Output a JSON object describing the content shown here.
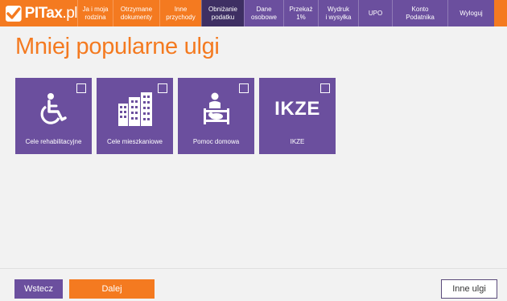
{
  "logo": {
    "text_main": "PITax",
    "text_suffix": ".pl"
  },
  "nav": [
    {
      "label": "Ja i moja\nrodzina",
      "style": "orange",
      "width": 44
    },
    {
      "label": "Otrzymane\ndokumenty",
      "style": "orange",
      "width": 58
    },
    {
      "label": "Inne\nprzychody",
      "style": "orange",
      "width": 52
    },
    {
      "label": "Obniżanie\npodatku",
      "style": "active",
      "width": 53
    },
    {
      "label": "Dane\nosobowe",
      "style": "purple",
      "width": 49
    },
    {
      "label": "Przekaż\n1%",
      "style": "purple",
      "width": 43
    },
    {
      "label": "Wydruk\ni wysyłka",
      "style": "purple",
      "width": 50
    },
    {
      "label": "UPO",
      "style": "purple",
      "width": 42
    },
    {
      "label": "Konto\nPodatnika",
      "style": "purple",
      "width": 69
    },
    {
      "label": "Wyloguj",
      "style": "purple",
      "width": 58
    }
  ],
  "page": {
    "title": "Mniej popularne ulgi"
  },
  "tiles": [
    {
      "label": "Cele rehabilitacyjne",
      "icon": "wheelchair-icon"
    },
    {
      "label": "Cele mieszkaniowe",
      "icon": "buildings-icon"
    },
    {
      "label": "Pomoc domowa",
      "icon": "nanny-crib-icon"
    },
    {
      "label": "IKZE",
      "icon": "ikze-text-icon",
      "icon_text": "IKZE"
    }
  ],
  "buttons": {
    "back": "Wstecz",
    "next": "Dalej",
    "other": "Inne ulgi"
  },
  "colors": {
    "orange": "#f47a20",
    "purple": "#6b4f9e",
    "active": "#3e2f63"
  }
}
